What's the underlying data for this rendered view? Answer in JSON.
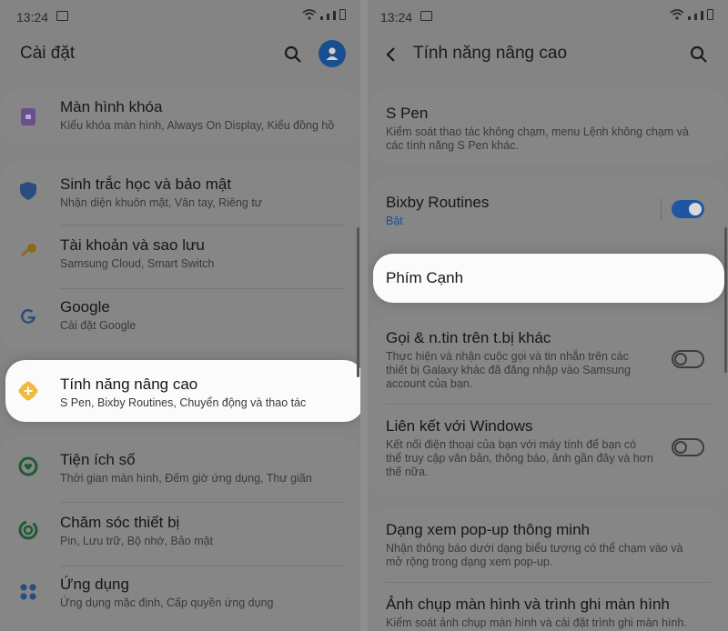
{
  "status": {
    "time": "13:24"
  },
  "left": {
    "title": "Cài đặt",
    "items": [
      {
        "title": "Màn hình khóa",
        "sub": "Kiểu khóa màn hình, Always On Display, Kiểu đồng hồ",
        "icon": "lock-icon"
      },
      {
        "title": "Sinh trắc học và bảo mật",
        "sub": "Nhận diện khuôn mặt, Vân tay, Riêng tư",
        "icon": "shield-icon"
      },
      {
        "title": "Tài khoản và sao lưu",
        "sub": "Samsung Cloud, Smart Switch",
        "icon": "key-icon"
      },
      {
        "title": "Google",
        "sub": "Cài đặt Google",
        "icon": "google-icon"
      },
      {
        "title": "Tính năng nâng cao",
        "sub": "S Pen, Bixby Routines, Chuyển động và thao tác",
        "icon": "advanced-features-icon"
      },
      {
        "title": "Tiện ích số",
        "sub": "Thời gian màn hình, Đếm giờ ứng dụng, Thư giãn",
        "icon": "digital-wellbeing-icon"
      },
      {
        "title": "Chăm sóc thiết bị",
        "sub": "Pin, Lưu trữ, Bộ nhớ, Bảo mật",
        "icon": "device-care-icon"
      },
      {
        "title": "Ứng dụng",
        "sub": "Ứng dụng mặc định, Cấp quyền ứng dụng",
        "icon": "apps-icon"
      }
    ]
  },
  "right": {
    "title": "Tính năng nâng cao",
    "spen": {
      "title": "S Pen",
      "sub1": "Kiểm soát thao tác không chạm, menu Lệnh không chạm và",
      "sub2": "các tính năng S Pen khác."
    },
    "bixby": {
      "title": "Bixby Routines",
      "sub": "Bật",
      "on": true
    },
    "edge": {
      "title": "Phím Cạnh"
    },
    "calls": {
      "title": "Gọi & n.tin trên t.bị khác",
      "sub1": "Thực hiện và nhận cuộc gọi và tin nhắn trên các",
      "sub2": "thiết bị Galaxy khác đã đăng nhập vào Samsung",
      "sub3": "account của bạn.",
      "on": false
    },
    "windows": {
      "title": "Liên kết với Windows",
      "sub1": "Kết nối điện thoại của bạn với máy tính để bạn có",
      "sub2": "thể truy cập văn bản, thông báo, ảnh gần đây và hơn",
      "sub3": "thế nữa.",
      "on": false
    },
    "popup": {
      "title": "Dạng xem pop-up thông minh",
      "sub1": "Nhận thông báo dưới dạng biểu tượng có thể chạm vào và",
      "sub2": "mở rộng trong dạng xem pop-up."
    },
    "screenshot": {
      "title": "Ảnh chụp màn hình và trình ghi màn hình",
      "sub": "Kiểm soát ảnh chụp màn hình và cài đặt trình ghi màn hình."
    }
  },
  "colors": {
    "highlight": "#fbfbfb",
    "accent": "#1f56a3",
    "dimmed_bg": "#848484"
  }
}
